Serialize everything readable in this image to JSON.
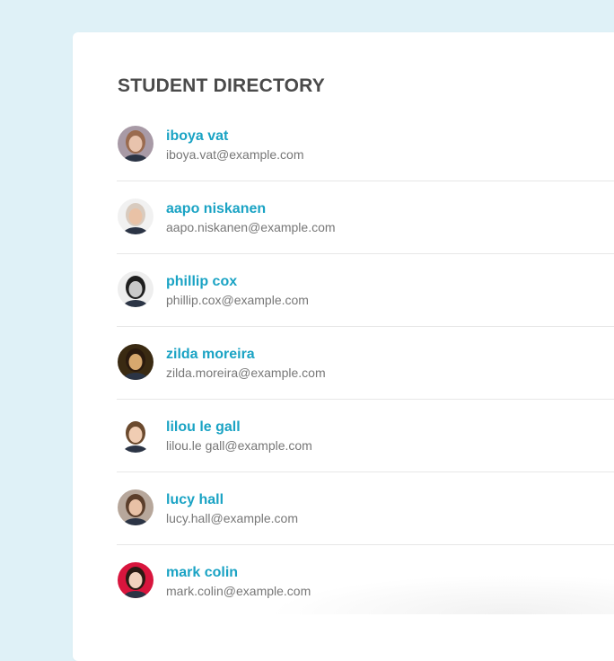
{
  "title": "STUDENT DIRECTORY",
  "students": [
    {
      "name": "iboya vat",
      "email": "iboya.vat@example.com",
      "avatar_icon": "avatar-photo",
      "skin": "#e8c3ad",
      "hair": "#9a6b4f",
      "bg": "#a89aa6"
    },
    {
      "name": "aapo niskanen",
      "email": "aapo.niskanen@example.com",
      "avatar_icon": "avatar-photo",
      "skin": "#e9c2a6",
      "hair": "#d8cbbf",
      "bg": "#f1f1f1"
    },
    {
      "name": "phillip cox",
      "email": "phillip.cox@example.com",
      "avatar_icon": "avatar-photo",
      "skin": "#c9c9c9",
      "hair": "#1e1e1e",
      "bg": "#eeeeee"
    },
    {
      "name": "zilda moreira",
      "email": "zilda.moreira@example.com",
      "avatar_icon": "avatar-photo",
      "skin": "#d7a86e",
      "hair": "#2a1a0e",
      "bg": "#3a2a12"
    },
    {
      "name": "lilou le gall",
      "email": "lilou.le gall@example.com",
      "avatar_icon": "avatar-photo",
      "skin": "#f0cdb3",
      "hair": "#6b4a2e",
      "bg": "#ffffff"
    },
    {
      "name": "lucy hall",
      "email": "lucy.hall@example.com",
      "avatar_icon": "avatar-photo",
      "skin": "#e8c1a6",
      "hair": "#5b3e2b",
      "bg": "#b7a79b"
    },
    {
      "name": "mark colin",
      "email": "mark.colin@example.com",
      "avatar_icon": "avatar-photo",
      "skin": "#f1d2be",
      "hair": "#2a1b14",
      "bg": "#d8153d"
    }
  ],
  "colors": {
    "page_bg": "#dff1f7",
    "card_bg": "#ffffff",
    "name": "#1aa3c4",
    "email": "#777777",
    "title": "#4a4a4a",
    "divider": "#e7e7e7"
  }
}
